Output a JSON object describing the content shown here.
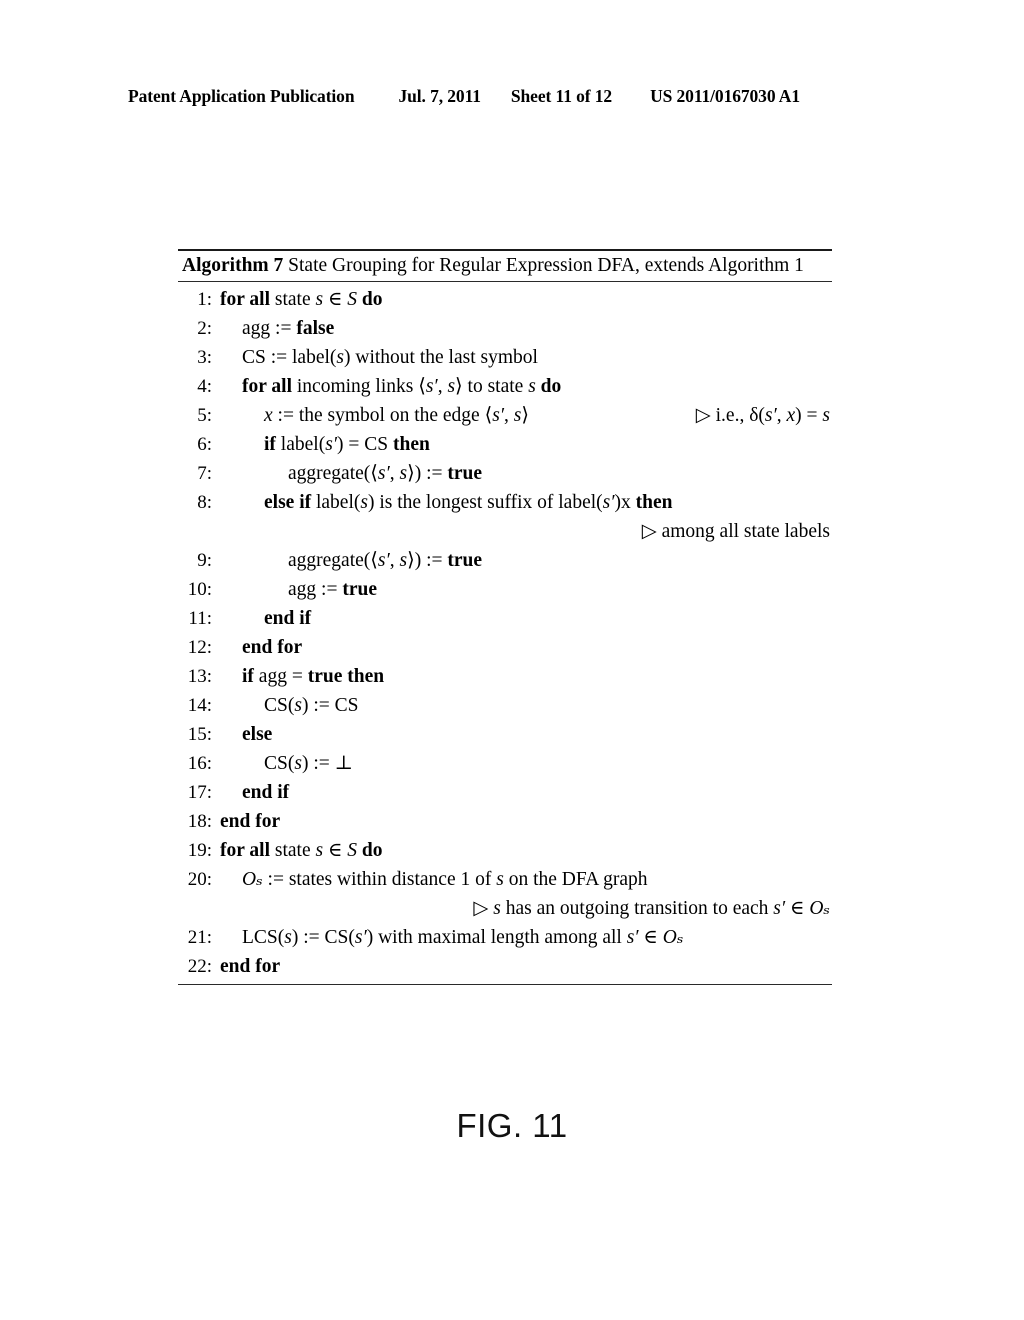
{
  "header": {
    "publication": "Patent Application Publication",
    "date": "Jul. 7, 2011",
    "sheet": "Sheet 11 of 12",
    "patent_number": "US 2011/0167030 A1"
  },
  "algorithm": {
    "label": "Algorithm 7",
    "caption": "State Grouping for Regular Expression DFA, extends Algorithm 1",
    "lines": [
      {
        "num": "1:",
        "indent": 0,
        "text": "for all state s ∈ S do"
      },
      {
        "num": "2:",
        "indent": 1,
        "text": "agg := false"
      },
      {
        "num": "3:",
        "indent": 1,
        "text": "CS := label(s) without the last symbol"
      },
      {
        "num": "4:",
        "indent": 1,
        "text": "for all incoming links ⟨s′, s⟩ to state s do"
      },
      {
        "num": "5:",
        "indent": 2,
        "text": "x :=  the symbol on the edge ⟨s′, s⟩",
        "comment": "▷ i.e., δ(s′, x) = s"
      },
      {
        "num": "6:",
        "indent": 2,
        "text": "if label(s′) = CS  then"
      },
      {
        "num": "7:",
        "indent": 3,
        "text": "aggregate(⟨s′, s⟩) := true"
      },
      {
        "num": "8:",
        "indent": 2,
        "text": "else if label(s) is the longest suffix of label(s′)x then"
      },
      {
        "num": "",
        "indent": 0,
        "comment_only": "▷ among all state labels"
      },
      {
        "num": "9:",
        "indent": 3,
        "text": "aggregate(⟨s′, s⟩) := true"
      },
      {
        "num": "10:",
        "indent": 3,
        "text": "agg := true"
      },
      {
        "num": "11:",
        "indent": 2,
        "text": "end if"
      },
      {
        "num": "12:",
        "indent": 1,
        "text": "end for"
      },
      {
        "num": "13:",
        "indent": 1,
        "text": "if agg = true then"
      },
      {
        "num": "14:",
        "indent": 2,
        "text": "CS(s) := CS"
      },
      {
        "num": "15:",
        "indent": 1,
        "text": "else"
      },
      {
        "num": "16:",
        "indent": 2,
        "text": "CS(s) := ⊥"
      },
      {
        "num": "17:",
        "indent": 1,
        "text": "end if"
      },
      {
        "num": "18:",
        "indent": 0,
        "text": "end for"
      },
      {
        "num": "19:",
        "indent": 0,
        "text": "for all state s ∈ S do"
      },
      {
        "num": "20:",
        "indent": 1,
        "text": "Oₛ := states within distance 1 of s on the DFA graph"
      },
      {
        "num": "",
        "indent": 0,
        "comment_only": "▷ s has an outgoing transition to each s′ ∈ Oₛ"
      },
      {
        "num": "21:",
        "indent": 1,
        "text": "LCS(s) := CS(s′) with maximal length among all s′ ∈ Oₛ"
      },
      {
        "num": "22:",
        "indent": 0,
        "text": "end for"
      }
    ]
  },
  "figure": {
    "caption": "FIG. 11"
  }
}
